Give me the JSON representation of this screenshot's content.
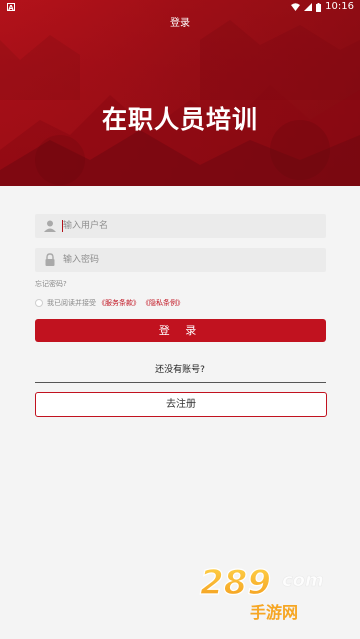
{
  "status_bar": {
    "notification_icon": "A",
    "time": "10:16"
  },
  "header": {
    "nav_title": "登录",
    "app_title": "在职人员培训"
  },
  "form": {
    "username_placeholder": "输入用户名",
    "password_placeholder": "输入密码",
    "forgot_password": "忘记密码?",
    "agree_prefix": "我已阅读并接受",
    "service_terms": "《服务条款》",
    "privacy_terms": "《隐私条例》",
    "login_button": "登 录",
    "no_account_text": "还没有账号?",
    "register_button": "去注册"
  },
  "colors": {
    "brand_red": "#c1121f",
    "header_red": "#b3121a"
  },
  "watermark": {
    "brand_number": "289",
    "brand_suffix": "com",
    "brand_text": "手游网"
  }
}
